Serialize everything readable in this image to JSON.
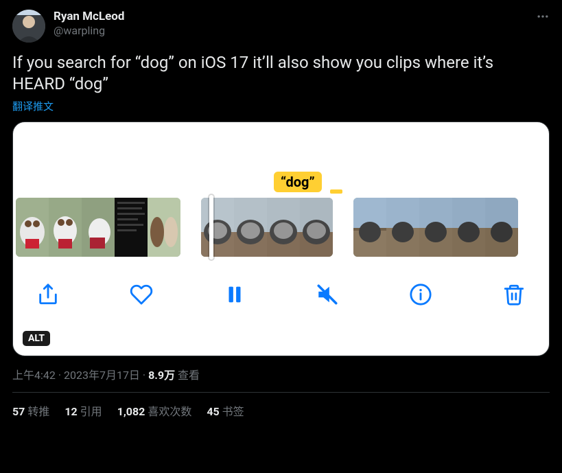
{
  "author": {
    "display_name": "Ryan McLeod",
    "handle": "@warpling"
  },
  "body": "If you search for “dog” on iOS 17 it’ll also show you clips where it’s HEARD “dog”",
  "translate_label": "翻译推文",
  "media": {
    "label": "“dog”",
    "alt_badge": "ALT"
  },
  "meta": {
    "time": "上午4:42",
    "date": "2023年7月17日",
    "views_count": "8.9万",
    "views_label": "查看",
    "sep": " · "
  },
  "stats": {
    "retweets_n": "57",
    "retweets_l": "转推",
    "quotes_n": "12",
    "quotes_l": "引用",
    "likes_n": "1,082",
    "likes_l": "喜欢次数",
    "bookmarks_n": "45",
    "bookmarks_l": "书签"
  }
}
